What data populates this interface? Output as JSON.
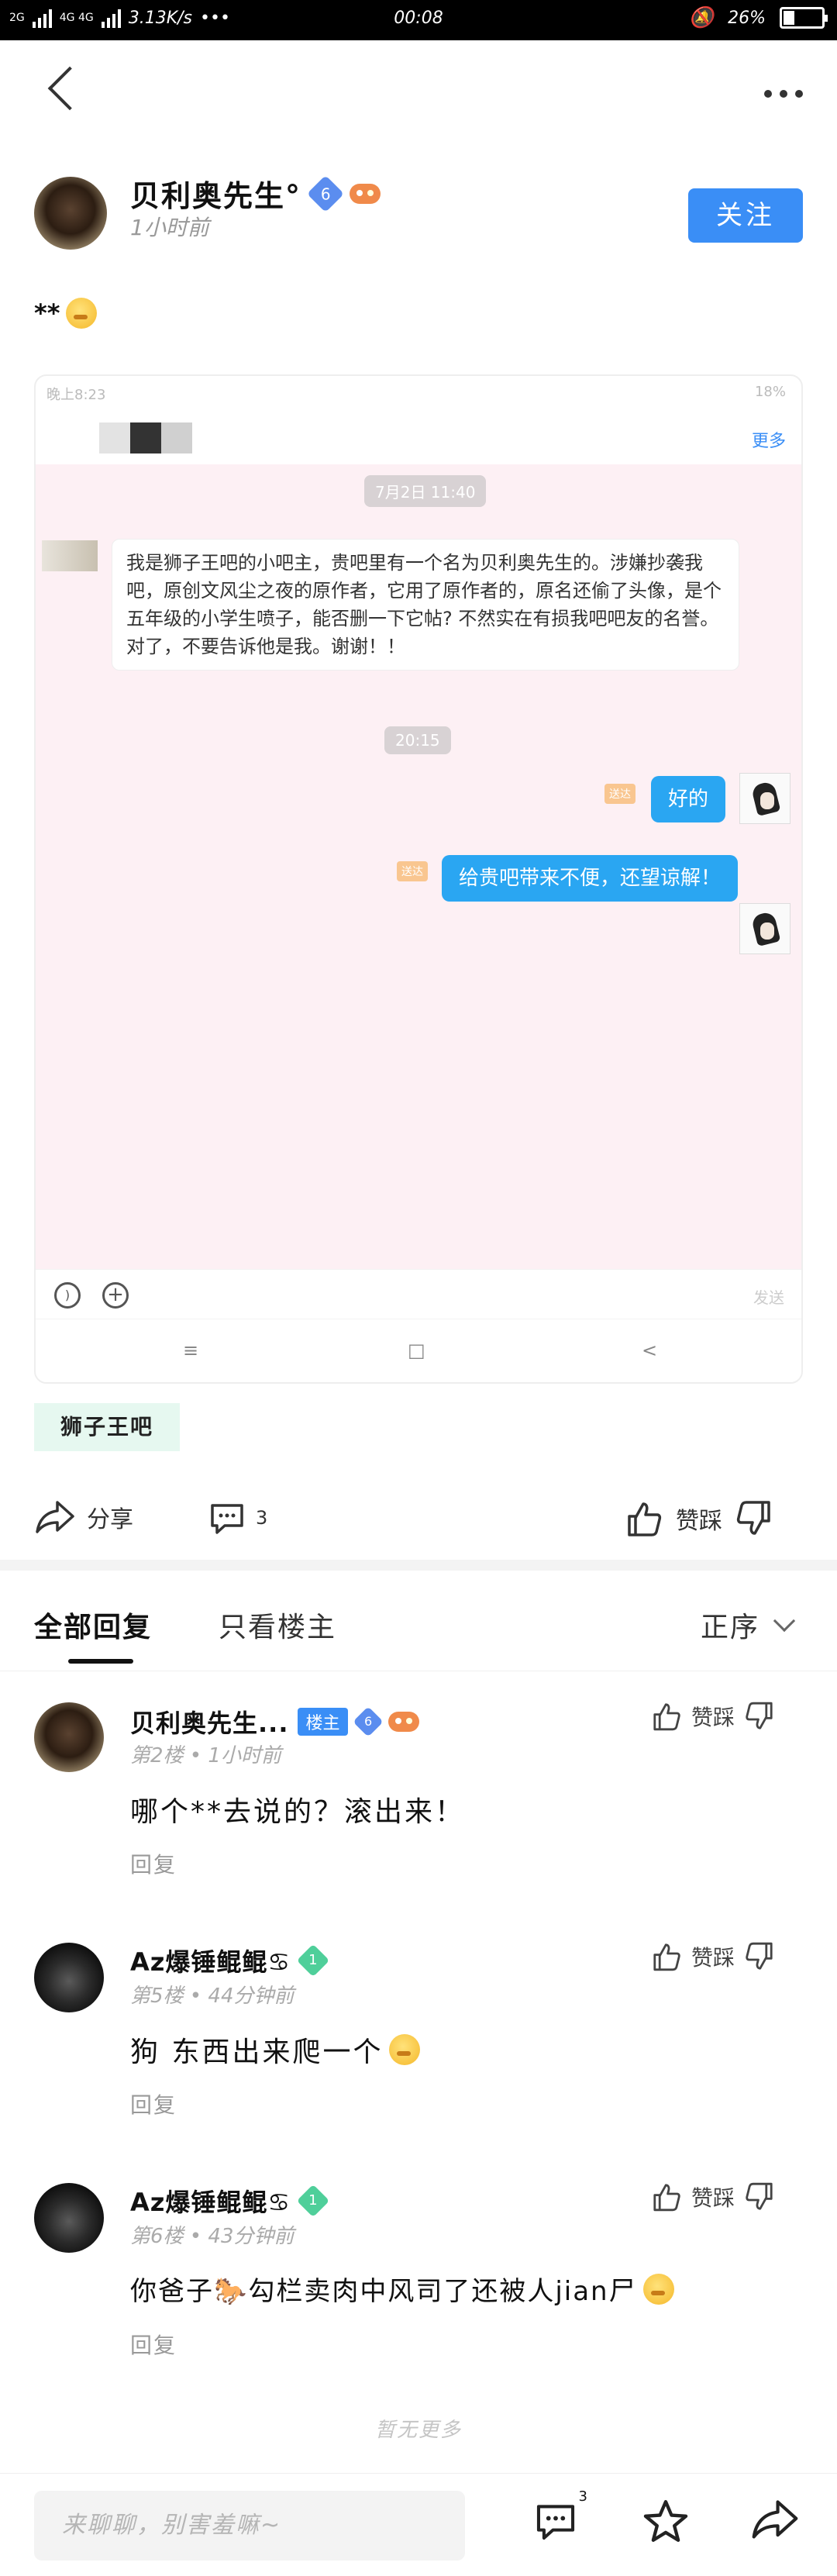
{
  "status_bar": {
    "signal_left": "2G",
    "signal_right": "4G 4G",
    "speed": "3.13K/s",
    "dots": "•••",
    "time": "00:08",
    "battery": "26%"
  },
  "post": {
    "author": "贝利奥先生°",
    "author_level": "6",
    "time_ago": "1小时前",
    "follow_label": "关注",
    "content": "**",
    "forum_tag": "狮子王吧",
    "share_label": "分享",
    "comment_count": "3",
    "like_label": "赞踩"
  },
  "screenshot": {
    "status_time": "晚上8:23",
    "status_battery": "18%",
    "more_label": "更多",
    "date_chip": "7月2日 11:40",
    "message_in": "我是狮子王吧的小吧主，贵吧里有一个名为贝利奥先生的。涉嫌抄袭我吧，原创文风尘之夜的原作者，它用了原作者的，原名还偷了头像，是个五年级的小学生喷子，能否删一下它帖? 不然实在有损我吧吧友的名誉。对了，不要告诉他是我。谢谢！！",
    "time_chip": "20:15",
    "sent_tag": "送达",
    "reply_1": "好的",
    "reply_2": "给贵吧带来不便，还望谅解！",
    "send_label": "发送",
    "nav": [
      "≡",
      "□",
      "<"
    ]
  },
  "tabs": {
    "all": "全部回复",
    "op_only": "只看楼主",
    "sort": "正序"
  },
  "replies": [
    {
      "name": "贝利奥先生...",
      "is_op_label": "楼主",
      "level": "6",
      "floor": "第2楼",
      "time": "1小时前",
      "body": "哪个**去说的？滚出来！",
      "reply_label": "回复",
      "like_label": "赞踩"
    },
    {
      "name": "Az爆锤鲲鲲♋",
      "level": "1",
      "floor": "第5楼",
      "time": "44分钟前",
      "body": "狗 东西出来爬一个",
      "reply_label": "回复",
      "like_label": "赞踩"
    },
    {
      "name": "Az爆锤鲲鲲♋",
      "level": "1",
      "floor": "第6楼",
      "time": "43分钟前",
      "body": "你爸子🐎勾栏卖肉中风司了还被人jian尸",
      "reply_label": "回复",
      "like_label": "赞踩"
    }
  ],
  "no_more": "暂无更多",
  "bottom_bar": {
    "placeholder": "来聊聊，别害羞嘛~",
    "comment_badge": "3"
  },
  "colors": {
    "accent": "#3a8ef6",
    "chat_bg": "#fdf0f4",
    "bubble_blue": "#2aa6f2"
  }
}
